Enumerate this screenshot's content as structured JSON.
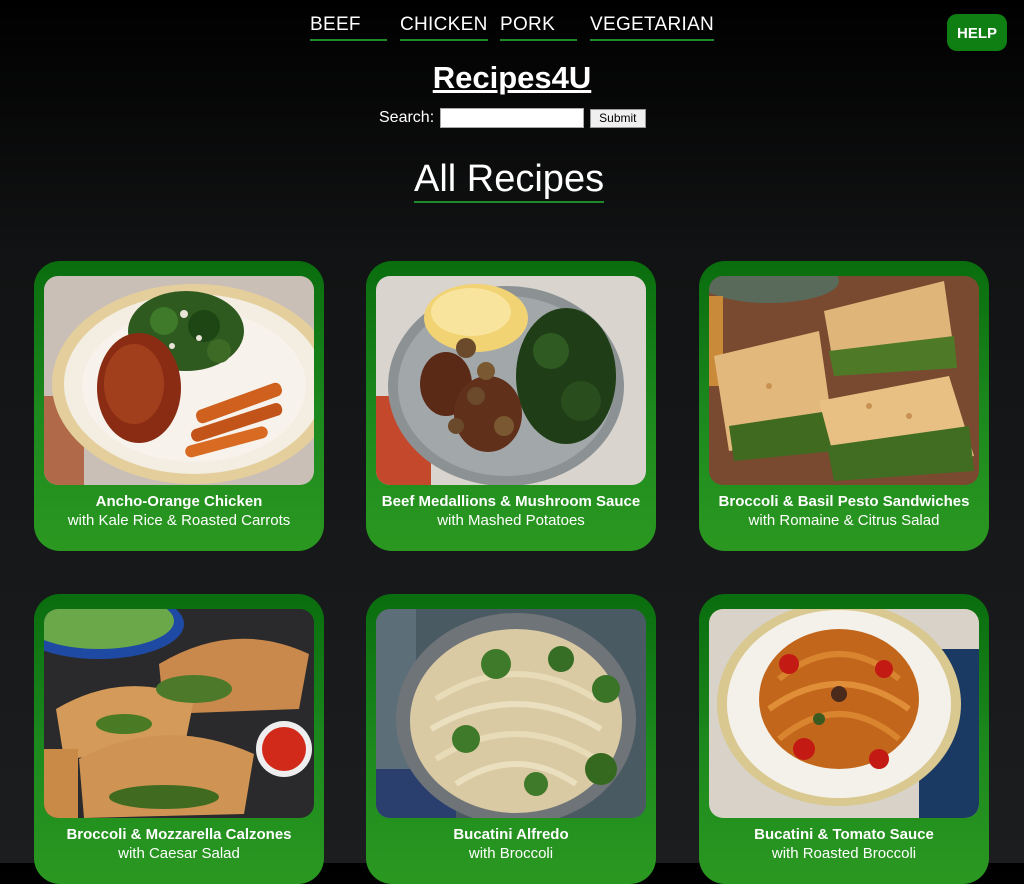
{
  "nav": {
    "items": [
      {
        "label": "BEEF"
      },
      {
        "label": "CHICKEN"
      },
      {
        "label": "PORK"
      },
      {
        "label": "VEGETARIAN"
      }
    ],
    "help_label": "HELP"
  },
  "header": {
    "site_title": "Recipes4U",
    "search_label": "Search:",
    "search_value": "",
    "submit_label": "Submit"
  },
  "main": {
    "section_title": "All Recipes",
    "recipes": [
      {
        "title": "Ancho-Orange Chicken",
        "subtitle": "with Kale Rice & Roasted Carrots"
      },
      {
        "title": "Beef Medallions & Mushroom Sauce",
        "subtitle": "with Mashed Potatoes"
      },
      {
        "title": "Broccoli & Basil Pesto Sandwiches",
        "subtitle": "with Romaine & Citrus Salad"
      },
      {
        "title": "Broccoli & Mozzarella Calzones",
        "subtitle": "with Caesar Salad"
      },
      {
        "title": "Bucatini Alfredo",
        "subtitle": "with Broccoli"
      },
      {
        "title": "Bucatini & Tomato Sauce",
        "subtitle": "with Roasted Broccoli"
      }
    ]
  },
  "colors": {
    "accent_green": "#0f7f14",
    "nav_underline": "#1f8a2a",
    "background": "#121314"
  }
}
